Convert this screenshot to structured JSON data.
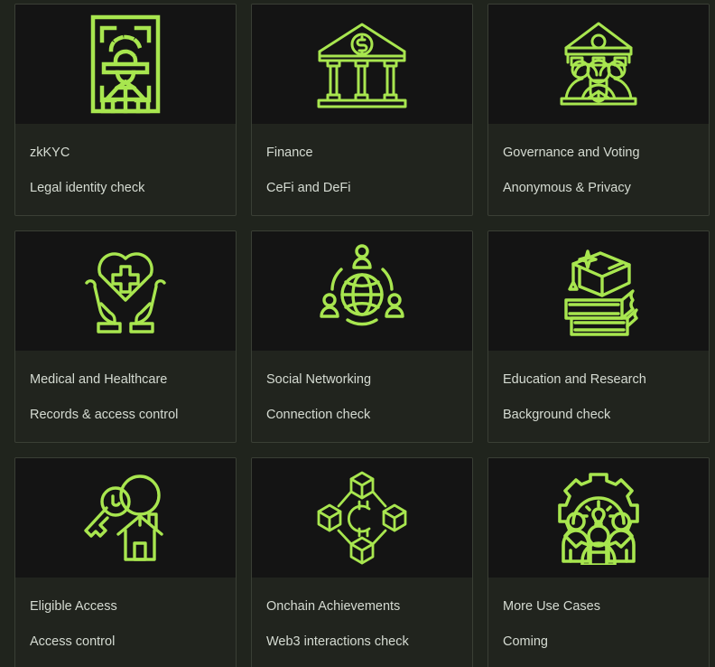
{
  "theme": {
    "page_background": "#20241d",
    "card_background": "#21241e",
    "media_background": "#141414",
    "card_border": "#3a3f35",
    "accent_green": "#a8e64f",
    "text_color": "#d5dbd2"
  },
  "grid": {
    "columns": 3,
    "rows": 3,
    "cards": [
      {
        "id": "zkkyc",
        "title": "zkKYC",
        "subtitle": "Legal identity check",
        "icon": "id-card-person-scan-icon"
      },
      {
        "id": "finance",
        "title": "Finance",
        "subtitle": "CeFi and DeFi",
        "icon": "bank-dollar-icon"
      },
      {
        "id": "governance-and-voting",
        "title": "Governance and Voting",
        "subtitle": "Anonymous & Privacy",
        "icon": "government-people-icon"
      },
      {
        "id": "medical-and-healthcare",
        "title": "Medical and Healthcare",
        "subtitle": "Records & access control",
        "icon": "hands-heart-cross-icon"
      },
      {
        "id": "social-networking",
        "title": "Social Networking",
        "subtitle": "Connection check",
        "icon": "globe-people-network-icon"
      },
      {
        "id": "education-and-research",
        "title": "Education and Research",
        "subtitle": "Background check",
        "icon": "graduation-cap-books-icon"
      },
      {
        "id": "eligible-access",
        "title": "Eligible Access",
        "subtitle": "Access control",
        "icon": "keys-house-icon"
      },
      {
        "id": "onchain-achievements",
        "title": "Onchain Achievements",
        "subtitle": "Web3 interactions check",
        "icon": "blockchain-crypto-nodes-icon"
      },
      {
        "id": "more-use-cases",
        "title": "More Use Cases",
        "subtitle": "Coming",
        "icon": "gear-people-lightbulb-icon"
      }
    ]
  }
}
